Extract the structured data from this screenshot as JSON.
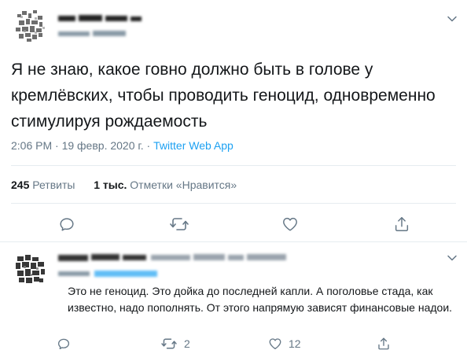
{
  "tweet": {
    "text": "Я не знаю, какое говно должно быть в голове у кремлёвских, чтобы проводить геноцид, одновременно стимулируя рождаемость",
    "time": "2:06 PM · 19 февр. 2020 г. · ",
    "source": "Twitter Web App",
    "retweets_count": "245",
    "retweets_label": "Ретвиты",
    "likes_count": "1 тыс.",
    "likes_label": "Отметки «Нравится»"
  },
  "reply": {
    "text": "Это не геноцид. Это дойка до последней капли. А поголовье стада, как известно, надо пополнять. От этого напрямую зависят финансовые надои.",
    "retweet_count": "2",
    "like_count": "12"
  },
  "icons": {
    "caret": "chevron-down-icon",
    "reply": "reply-icon",
    "retweet": "retweet-icon",
    "like": "heart-icon",
    "share": "share-icon"
  },
  "colors": {
    "link": "#1da1f2",
    "secondary_text": "#657786",
    "divider": "#e6ecf0"
  }
}
